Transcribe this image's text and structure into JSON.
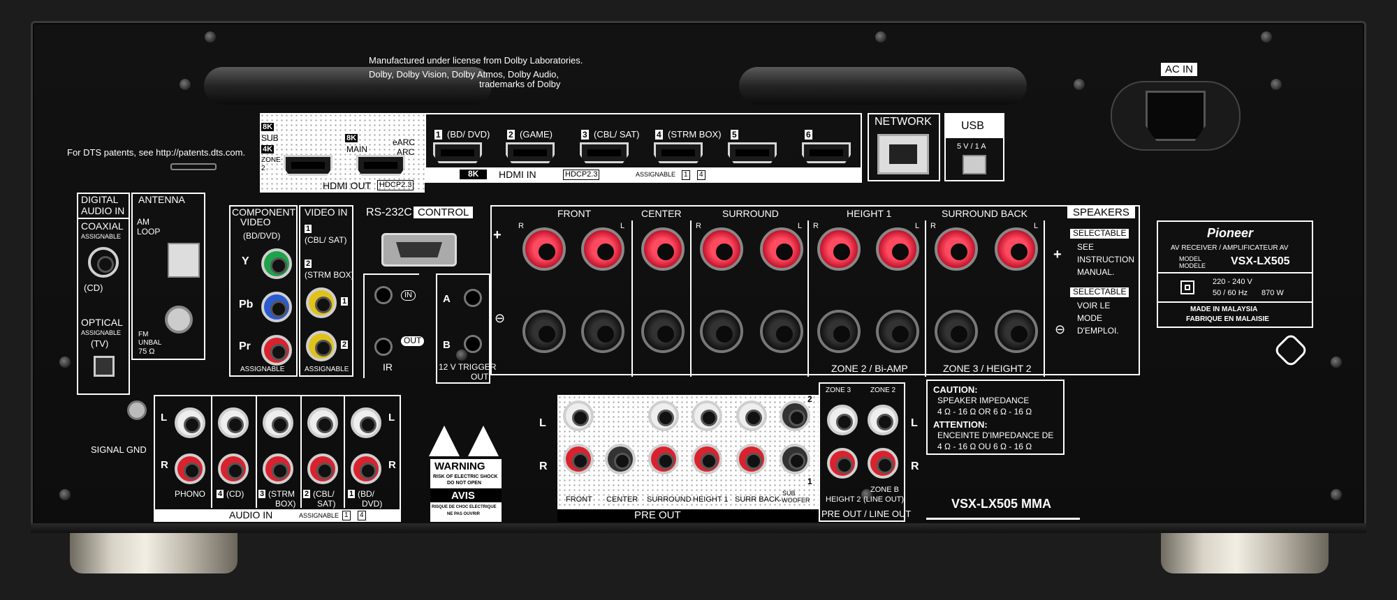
{
  "top": {
    "license_lines": [
      "Manufactured under license from Dolby Laboratories.",
      "Dolby, Dolby Vision, Dolby Atmos, Dolby Audio,",
      "trademarks of Dolby"
    ],
    "dts_notice": "For DTS patents, see http://patents.dts.com."
  },
  "hdmi_out": {
    "badges": [
      "8K",
      "SUB",
      "4K",
      "ZONE 2",
      "8K",
      "MAIN",
      "eARC",
      "ARC"
    ],
    "label": "HDMI OUT",
    "hdcp": "HDCP2.3"
  },
  "hdmi_in": {
    "ports": [
      "1",
      "(BD/ DVD)",
      "2",
      "(GAME)",
      "3",
      "(CBL/ SAT)",
      "4",
      "(STRM BOX)",
      "5",
      "6"
    ],
    "badge_8k": "8K",
    "label": "HDMI IN",
    "hdcp": "HDCP2.3",
    "assignable": "ASSIGNABLE",
    "assign_range": [
      "1",
      "4"
    ]
  },
  "network": {
    "label": "NETWORK"
  },
  "usb": {
    "label": "USB",
    "rating": "5 V / 1 A"
  },
  "ac_in": {
    "label": "AC IN"
  },
  "digital_audio": {
    "title": [
      "DIGITAL",
      "AUDIO IN"
    ],
    "coaxial": "COAXIAL",
    "coax_assign": "ASSIGNABLE",
    "coax_input": "(CD)",
    "optical": "OPTICAL",
    "opt_assign": "ASSIGNABLE",
    "opt_input": "(TV)"
  },
  "antenna": {
    "title": "ANTENNA",
    "am": [
      "AM",
      "LOOP"
    ],
    "fm": [
      "FM",
      "UNBAL",
      "75 Ω"
    ]
  },
  "component": {
    "title": [
      "COMPONENT",
      "VIDEO"
    ],
    "source": "(BD/DVD)",
    "labels": [
      "Y",
      "Pb",
      "Pr"
    ],
    "assignable": "ASSIGNABLE"
  },
  "video_in": {
    "title": "VIDEO IN",
    "entries": [
      "1",
      "(CBL/ SAT)",
      "2",
      "(STRM BOX)"
    ],
    "jack_nums": [
      "1",
      "2"
    ],
    "assignable": "ASSIGNABLE"
  },
  "control": {
    "rs232": "RS-232C",
    "title": "CONTROL",
    "ir_in": "IN",
    "ir_out": "OUT",
    "ir": "IR",
    "trig_a": "A",
    "trig_b": "B",
    "trigger": [
      "12 V",
      "TRIGGER",
      "OUT"
    ]
  },
  "speakers": {
    "title": "SPEAKERS",
    "groups": [
      "FRONT",
      "CENTER",
      "SURROUND",
      "HEIGHT 1",
      "SURROUND BACK"
    ],
    "rl": [
      "R",
      "L",
      "R",
      "L",
      "R",
      "L",
      "R",
      "L"
    ],
    "plus": "+",
    "minus": "⊖",
    "zone2": "ZONE 2 / Bi-AMP",
    "zone3": "ZONE 3 / HEIGHT 2",
    "selectable": "SELECTABLE",
    "note_en": [
      "SEE",
      "INSTRUCTION",
      "MANUAL."
    ],
    "note_fr": [
      "VOIR LE",
      "MODE",
      "D'EMPLOI."
    ]
  },
  "rating": {
    "brand": "Pioneer",
    "type": "AV RECEIVER / AMPLIFICATEUR AV",
    "model_label": [
      "MODEL",
      "MODELE"
    ],
    "model": "VSX-LX505",
    "voltage": "220 - 240 V",
    "freq": "50 / 60 Hz",
    "power": "870 W",
    "origin": [
      "MADE IN MALAYSIA",
      "FABRIQUE EN MALAISIE"
    ]
  },
  "gnd": {
    "label": "SIGNAL GND"
  },
  "audio_in": {
    "sides": [
      "L",
      "R",
      "L",
      "R"
    ],
    "inputs": [
      "PHONO",
      "4",
      "(CD)",
      "3",
      "(STRM",
      "BOX)",
      "2",
      "(CBL/",
      "SAT)",
      "1",
      "(BD/",
      "DVD)"
    ],
    "label": "AUDIO IN",
    "assignable": "ASSIGNABLE",
    "assign_range": [
      "1",
      "4"
    ]
  },
  "warning": {
    "title": "WARNING",
    "line1": "RISK OF ELECTRIC SHOCK",
    "line2": "DO NOT OPEN",
    "avis": "AVIS",
    "fr1": "RISQUE DE CHOC ELECTRIQUE",
    "fr2": "NE PAS OUVRIR"
  },
  "pre_out": {
    "sides": [
      "L",
      "R"
    ],
    "channels": [
      "FRONT",
      "CENTER",
      "SURROUND",
      "HEIGHT 1",
      "SURR BACK",
      "SUB",
      "-WOOFER"
    ],
    "sub_nums": [
      "2",
      "1"
    ],
    "label": "PRE OUT"
  },
  "zone_out": {
    "zone3": "ZONE 3",
    "zone2": "ZONE 2",
    "height2": "HEIGHT 2",
    "zoneb": [
      "ZONE B",
      "(LINE OUT)"
    ],
    "label": "PRE OUT / LINE OUT",
    "sides": [
      "L",
      "R"
    ]
  },
  "caution": {
    "title": "CAUTION:",
    "l1": "SPEAKER IMPEDANCE",
    "l2": "4 Ω - 16 Ω  OR  6 Ω - 16 Ω",
    "att": "ATTENTION:",
    "l3": "ENCEINTE D'IMPEDANCE DE",
    "l4": "4 Ω - 16 Ω  OU  6 Ω - 16 Ω"
  },
  "model_footer": "VSX-LX505 MMA"
}
